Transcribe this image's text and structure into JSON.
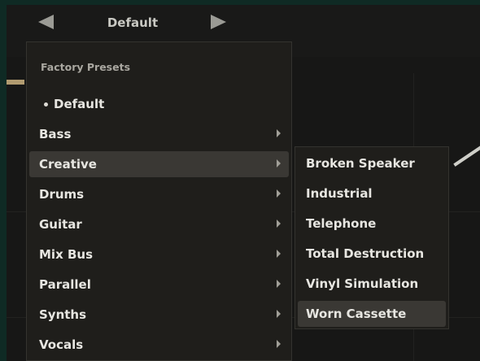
{
  "header": {
    "preset_name": "Default"
  },
  "menu": {
    "header": "Factory Presets",
    "default_item": "Default",
    "items": [
      {
        "label": "Bass"
      },
      {
        "label": "Creative"
      },
      {
        "label": "Drums"
      },
      {
        "label": "Guitar"
      },
      {
        "label": "Mix Bus"
      },
      {
        "label": "Parallel"
      },
      {
        "label": "Synths"
      },
      {
        "label": "Vocals"
      }
    ]
  },
  "submenu": {
    "items": [
      {
        "label": "Broken Speaker"
      },
      {
        "label": "Industrial"
      },
      {
        "label": "Telephone"
      },
      {
        "label": "Total Destruction"
      },
      {
        "label": "Vinyl Simulation"
      },
      {
        "label": "Worn Cassette"
      }
    ]
  },
  "colors": {
    "background": "#151514",
    "menu_background": "#1f1e1b",
    "selected_item": "#3a3834",
    "text": "#e7e6e1"
  }
}
